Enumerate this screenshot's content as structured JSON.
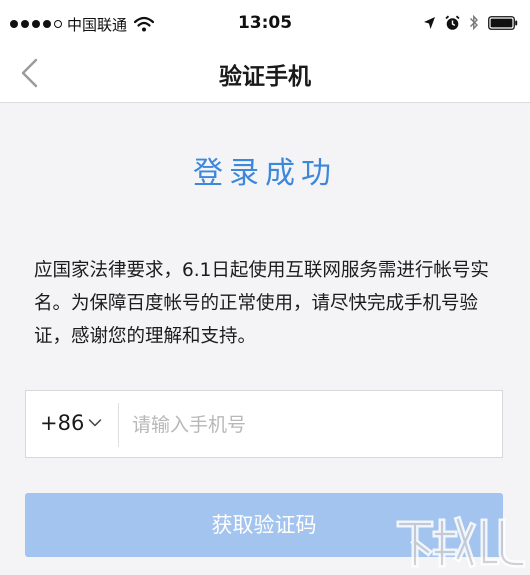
{
  "status_bar": {
    "carrier": "中国联通",
    "time": "13:05",
    "icons": [
      "signal-dots-icon",
      "wifi-icon",
      "location-arrow-icon",
      "alarm-icon",
      "bluetooth-icon",
      "battery-icon"
    ]
  },
  "nav": {
    "back_icon": "chevron-left-icon",
    "title": "验证手机"
  },
  "main": {
    "headline": "登录成功",
    "notice": "应国家法律要求，6.1日起使用互联网服务需进行帐号实名。为保障百度帐号的正常使用，请尽快完成手机号验证，感谢您的理解和支持。"
  },
  "phone_form": {
    "country_code": "+86",
    "phone_value": "",
    "phone_placeholder": "请输入手机号",
    "get_code_label": "获取验证码"
  },
  "colors": {
    "headline": "#3e88dc",
    "button_disabled": "#a2c4ee",
    "background": "#f4f4f6"
  }
}
